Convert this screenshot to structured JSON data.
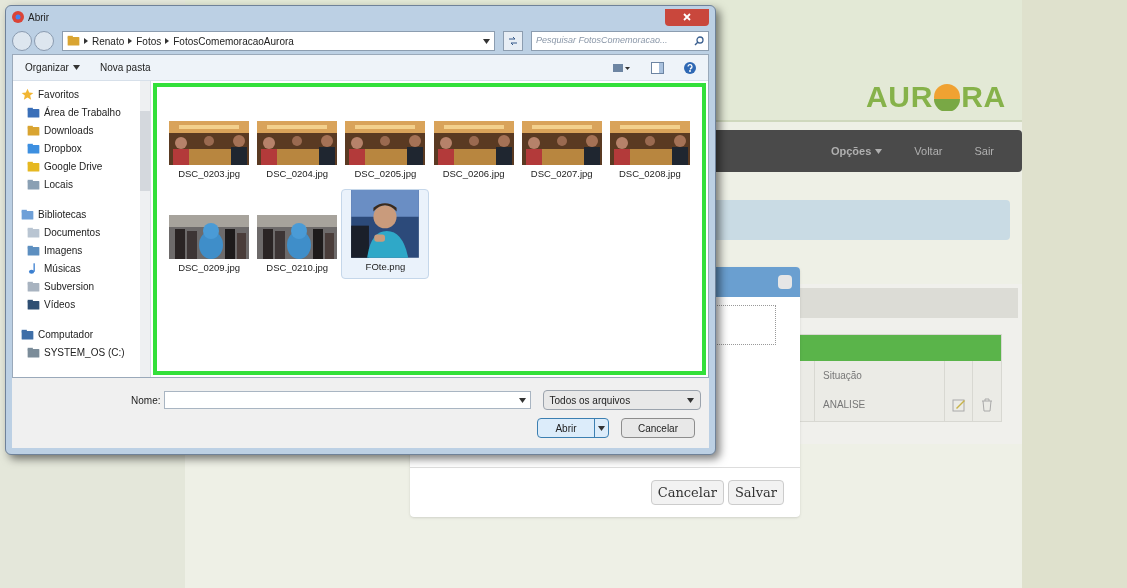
{
  "page": {
    "logo": {
      "before": "AUR",
      "after": "RA"
    },
    "navbar": [
      {
        "label": "Opções",
        "dropdown": true
      },
      {
        "label": "Voltar",
        "dropdown": false
      },
      {
        "label": "Sair",
        "dropdown": false
      }
    ],
    "table": {
      "columns": [
        "Situação"
      ],
      "rows": [
        [
          "ANALISE"
        ]
      ]
    },
    "modal": {
      "buttons": [
        "Cancelar",
        "Salvar"
      ]
    }
  },
  "dialog": {
    "title": "Abrir",
    "breadcrumb": [
      "Renato",
      "Fotos",
      "FotosComemoracaoAurora"
    ],
    "search": {
      "placeholder": "Pesquisar FotosComemoracao..."
    },
    "toolbar": [
      {
        "label": "Organizar",
        "dropdown": true
      },
      {
        "label": "Nova pasta",
        "dropdown": false
      }
    ],
    "nav": [
      {
        "label": "Favoritos",
        "kind": "star",
        "children": [
          {
            "label": "Área de Trabalho",
            "kind": "desktop"
          },
          {
            "label": "Downloads",
            "kind": "folder"
          },
          {
            "label": "Dropbox",
            "kind": "dropbox"
          },
          {
            "label": "Google Drive",
            "kind": "drive"
          },
          {
            "label": "Locais",
            "kind": "places"
          }
        ]
      },
      {
        "label": "Bibliotecas",
        "kind": "library",
        "children": [
          {
            "label": "Documentos",
            "kind": "document"
          },
          {
            "label": "Imagens"
          },
          {
            "label": "Músicas",
            "kind": "music"
          },
          {
            "label": "Subversion",
            "kind": "svn"
          },
          {
            "label": "Vídeos",
            "kind": "video"
          }
        ]
      },
      {
        "label": "Computador",
        "kind": "computer",
        "children": [
          {
            "label": "SYSTEM_OS (C:)",
            "kind": "disk"
          }
        ]
      }
    ],
    "files": [
      {
        "name": "DSC_0203.jpg",
        "kind": "restaurant",
        "selected": false
      },
      {
        "name": "DSC_0204.jpg",
        "kind": "restaurant",
        "selected": false
      },
      {
        "name": "DSC_0205.jpg",
        "kind": "restaurant",
        "selected": false
      },
      {
        "name": "DSC_0206.jpg",
        "kind": "restaurant",
        "selected": false
      },
      {
        "name": "DSC_0207.jpg",
        "kind": "restaurant",
        "selected": false
      },
      {
        "name": "DSC_0208.jpg",
        "kind": "restaurant",
        "selected": false
      },
      {
        "name": "DSC_0209.jpg",
        "kind": "mascot",
        "selected": false
      },
      {
        "name": "DSC_0210.jpg",
        "kind": "mascot",
        "selected": false
      },
      {
        "name": "FOte.png",
        "kind": "portrait",
        "selected": true
      }
    ],
    "name_field": {
      "label": "Nome:"
    },
    "filter": "Todos os arquivos",
    "buttons": [
      {
        "label": "Abrir",
        "kind": "split"
      },
      {
        "label": "Cancelar",
        "kind": "plain"
      }
    ]
  }
}
